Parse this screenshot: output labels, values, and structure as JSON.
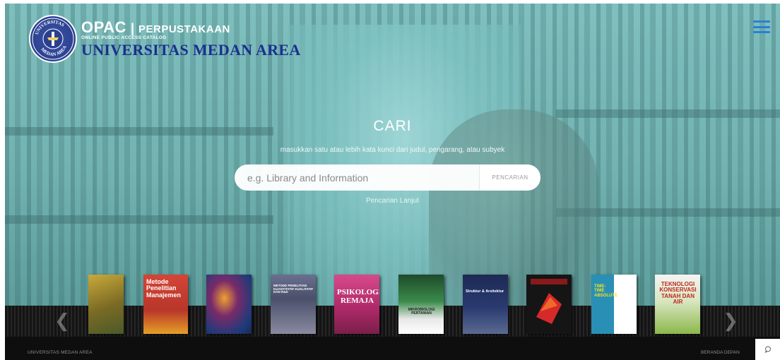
{
  "header": {
    "seal_text": "UNIVERSITAS MEDAN AREA",
    "opac": "OPAC",
    "separator": "|",
    "perpustakaan": "PERPUSTAKAAN",
    "subtitle": "ONLINE PUBLIC ACCESS CATALOG",
    "university": "UNIVERSITAS MEDAN AREA"
  },
  "search": {
    "heading": "CARI",
    "hint": "masukkan satu atau lebih kata kunci dari judul, pengarang, atau subyek",
    "placeholder": "e.g. Library and Information",
    "value": "",
    "button_label": "PENCARIAN",
    "advanced_label": "Pencarian Lanjut"
  },
  "carousel": {
    "prev_icon": "chevron-left-icon",
    "next_icon": "chevron-right-icon",
    "books": [
      {
        "title": "",
        "color": "#8a7a30"
      },
      {
        "title": "Metode Penelitian Manajemen",
        "color": "#c0392b"
      },
      {
        "title": "",
        "color": "#2a4d8a"
      },
      {
        "title": "METODE PENELITIAN KUANTITATIF KUALITATIF DAN R&D",
        "color": "#4a4f6a"
      },
      {
        "title": "PSIKOLOGI REMAJA",
        "color": "#c23a7a"
      },
      {
        "title": "MIKROBIOLOGI PERTANIAN",
        "color": "#2f7a3a"
      },
      {
        "title": "Struktur & Arsitektur",
        "color": "#1d2a55"
      },
      {
        "title": "",
        "color": "#1a1a1a"
      },
      {
        "title": "TIME-TIME ABSOLUTE",
        "color": "#2a8fb4"
      },
      {
        "title": "TEKNOLOGI KONSERVASI TANAH DAN AIR",
        "color": "#8cb84a"
      }
    ]
  },
  "footer": {
    "left_text": "UNIVERSITAS MEDAN AREA",
    "right_link": "BERANDA DEPAN",
    "chat_icon": "chat-bubble-icon"
  },
  "colors": {
    "brand_blue": "#1c2f8f",
    "menu_blue": "#2a7fd6",
    "hero_teal": "#7cbcbb"
  }
}
